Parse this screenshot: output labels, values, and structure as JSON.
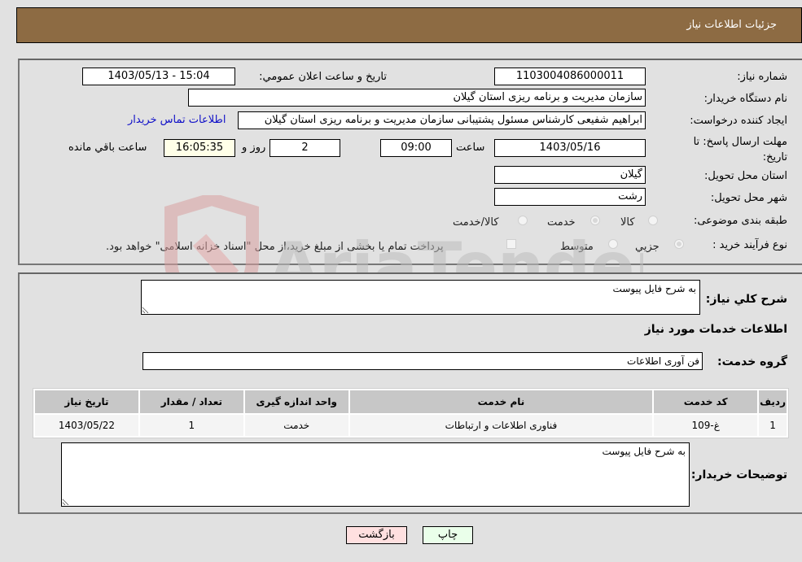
{
  "header": {
    "title": "جزئيات اطلاعات نياز"
  },
  "form": {
    "need_number": {
      "label": "شماره نياز:",
      "value": "1103004086000011"
    },
    "announce_datetime": {
      "label": "تاريخ و ساعت اعلان عمومي:",
      "value": "1403/05/13 - 15:04"
    },
    "buyer_org": {
      "label": "نام دستگاه خريدار:",
      "value": "سازمان مديريت و برنامه ريزی استان گيلان"
    },
    "requester": {
      "label": "ايجاد کننده درخواست:",
      "value": "ابراهيم  شفيعی کارشناس مسئول پشتيبانی سازمان مديريت و برنامه ريزی استان گيلان"
    },
    "buyer_contact_link": "اطلاعات تماس خريدار",
    "deadline": {
      "label": "مهلت ارسال پاسخ: تا تاريخ:",
      "date": "1403/05/16",
      "time_label": "ساعت",
      "time": "09:00",
      "days": "2",
      "days_label": "روز و",
      "remaining": "16:05:35",
      "remaining_label": "ساعت باقي مانده"
    },
    "delivery_province": {
      "label": "استان محل تحويل:",
      "value": "گيلان"
    },
    "delivery_city": {
      "label": "شهر محل تحويل:",
      "value": "رشت"
    },
    "category": {
      "label": "طبقه بندی موضوعی:",
      "options": [
        "کالا",
        "خدمت",
        "کالا/خدمت"
      ],
      "selected": "خدمت"
    },
    "purchase_type": {
      "label": "نوع فرآيند خريد :",
      "options": [
        "جزيي",
        "متوسط"
      ],
      "selected": "جزيي",
      "treasury_note": "پرداخت تمام يا بخشی از مبلغ خريد،از محل \"اسناد خزانه اسلامی\" خواهد بود."
    }
  },
  "details": {
    "general_desc_label": "شرح کلي نياز:",
    "general_desc": "به شرح فايل پيوست",
    "services_heading": "اطلاعات خدمات مورد نياز",
    "service_group_label": "گروه خدمت:",
    "service_group": "فن آوری اطلاعات",
    "table": {
      "headers": [
        "رديف",
        "کد خدمت",
        "نام خدمت",
        "واحد اندازه گيری",
        "تعداد / مقدار",
        "تاريخ نياز"
      ],
      "rows": [
        [
          "1",
          "غ-109",
          "فناوری اطلاعات و ارتباطات",
          "خدمت",
          "1",
          "1403/05/22"
        ]
      ]
    },
    "buyer_notes_label": "توضيحات خريدار:",
    "buyer_notes": "به شرح فايل پيوست"
  },
  "buttons": {
    "print": "چاپ",
    "back": "بازگشت"
  },
  "watermark": {
    "text": "AriaTender.neT"
  }
}
